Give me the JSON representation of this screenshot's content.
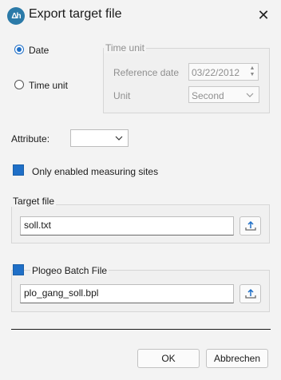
{
  "window": {
    "title": "Export target file",
    "close_glyph": "✕",
    "app_icon_text": "Δh"
  },
  "mode": {
    "date_label": "Date",
    "time_unit_label": "Time unit",
    "selected": "Date"
  },
  "time_unit_group": {
    "legend": "Time unit",
    "reference_date_label": "Reference date",
    "reference_date_value": "03/22/2012",
    "unit_label": "Unit",
    "unit_value": "Second"
  },
  "attribute": {
    "label": "Attribute:",
    "value": ""
  },
  "only_enabled": {
    "label": "Only enabled measuring sites",
    "checked": true
  },
  "target_file": {
    "legend": "Target file",
    "value": "soll.txt",
    "browse_icon": "upload-icon"
  },
  "plogeo": {
    "label": "Plogeo Batch File",
    "checked": true,
    "value": "plo_gang_soll.bpl",
    "browse_icon": "upload-icon"
  },
  "buttons": {
    "ok": "OK",
    "cancel": "Abbrechen"
  },
  "colors": {
    "accent": "#1f6fc7",
    "background": "#f3f3f3"
  }
}
